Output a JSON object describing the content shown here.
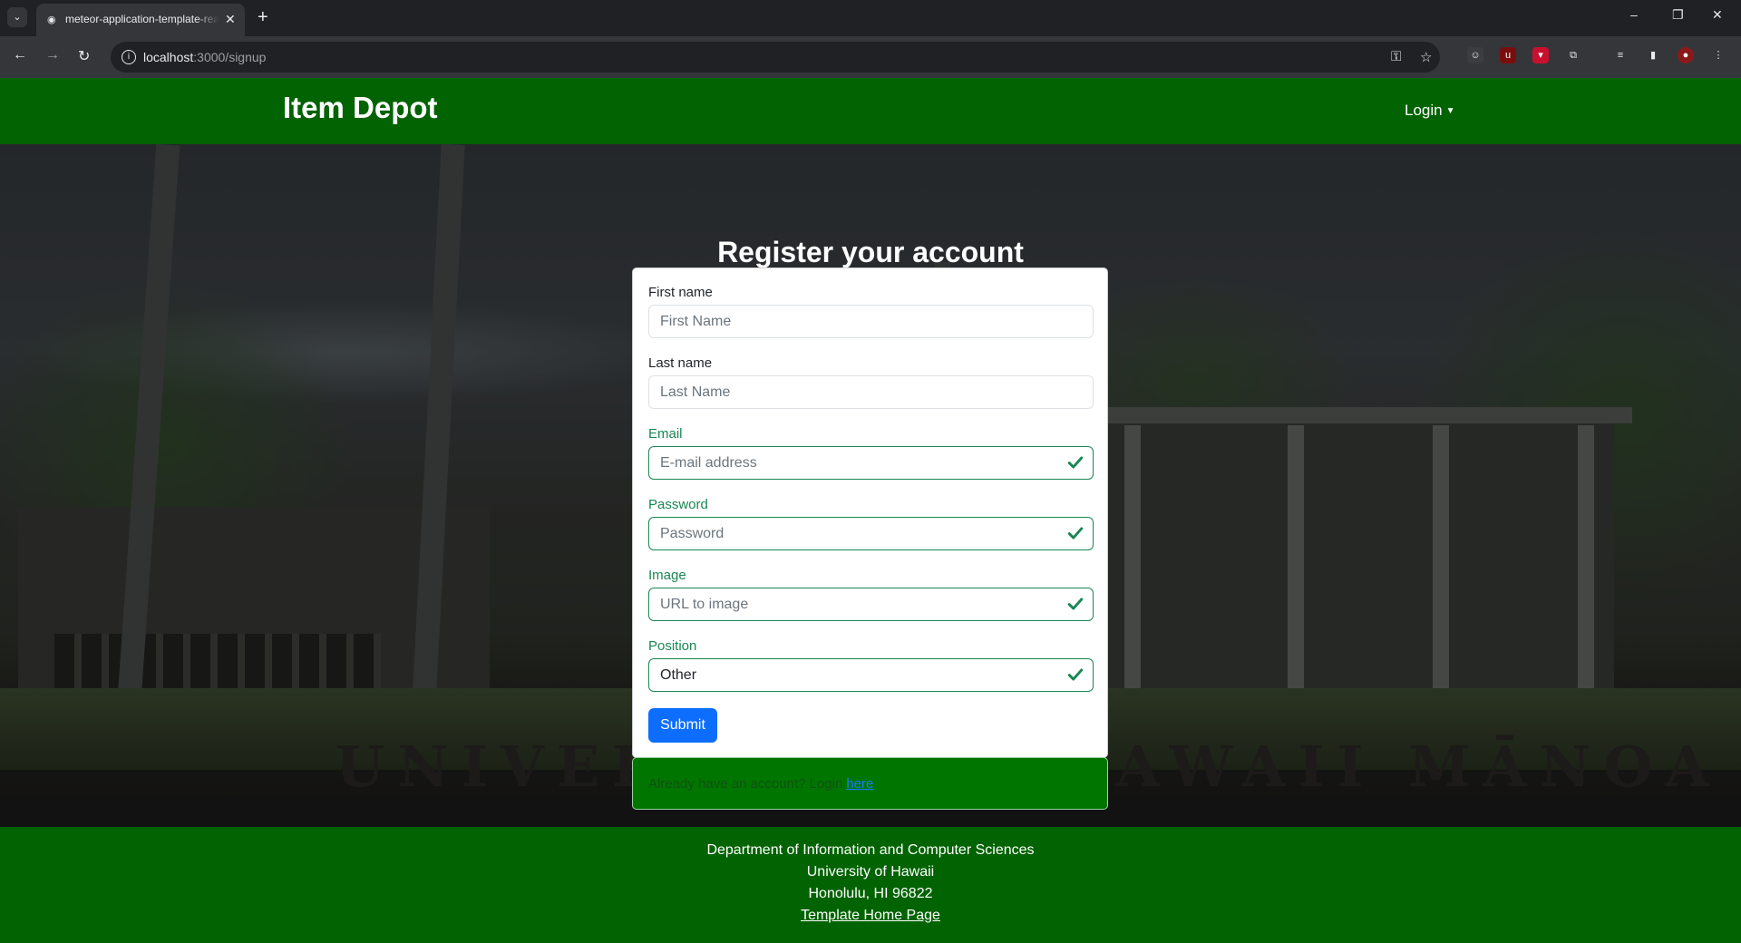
{
  "browser": {
    "tab_title": "meteor-application-template-react",
    "url_host": "localhost",
    "url_path": ":3000/signup",
    "icons": [
      "tab-list-icon",
      "tab-favicon",
      "tab-close-icon",
      "new-tab-icon",
      "minimize-icon",
      "restore-icon",
      "close-window-icon",
      "back-icon",
      "forward-icon",
      "reload-icon",
      "site-info-icon",
      "password-key-icon",
      "bookmark-star-icon",
      "extensions-icon",
      "media-icon",
      "side-panel-icon",
      "profile-avatar-icon",
      "menu-icon"
    ]
  },
  "navbar": {
    "brand": "Item Depot",
    "login_label": "Login"
  },
  "hero": {
    "sign_text": "UNIVERSITY OF HAWAII MĀNOA"
  },
  "form": {
    "title": "Register your account",
    "fields": [
      {
        "label": "First name",
        "placeholder": "First Name",
        "value": "",
        "valid": false
      },
      {
        "label": "Last name",
        "placeholder": "Last Name",
        "value": "",
        "valid": false
      },
      {
        "label": "Email",
        "placeholder": "E-mail address",
        "value": "",
        "valid": true
      },
      {
        "label": "Password",
        "placeholder": "Password",
        "value": "",
        "valid": true
      },
      {
        "label": "Image",
        "placeholder": "URL to image",
        "value": "",
        "valid": true
      },
      {
        "label": "Position",
        "placeholder": "",
        "value": "Other",
        "valid": true
      }
    ],
    "submit_label": "Submit",
    "valid_color": "#198754"
  },
  "alert": {
    "text": "Already have an account? Login",
    "link_text": "here"
  },
  "footer": {
    "line1": "Department of Information and Computer Sciences",
    "line2": "University of Hawaii",
    "line3": "Honolulu, HI 96822",
    "link": "Template Home Page"
  },
  "colors": {
    "navbar": "#026302",
    "submit": "#0d6efd",
    "alert_bg": "#007600"
  }
}
